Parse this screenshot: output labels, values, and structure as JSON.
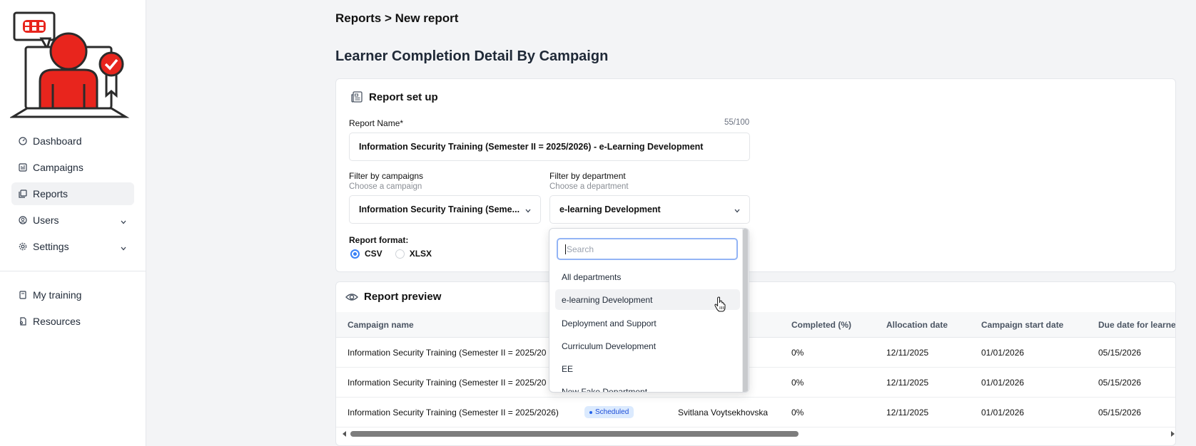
{
  "sidebar": {
    "items": [
      {
        "label": "Dashboard",
        "icon": "dashboard-icon"
      },
      {
        "label": "Campaigns",
        "icon": "campaigns-icon"
      },
      {
        "label": "Reports",
        "icon": "reports-icon",
        "active": true
      },
      {
        "label": "Users",
        "icon": "users-icon",
        "expandable": true
      },
      {
        "label": "Settings",
        "icon": "settings-icon",
        "expandable": true
      }
    ],
    "secondary": [
      {
        "label": "My training",
        "icon": "my-training-icon"
      },
      {
        "label": "Resources",
        "icon": "resources-icon"
      }
    ]
  },
  "breadcrumb": "Reports > New report",
  "page_title": "Learner Completion Detail By Campaign",
  "setup": {
    "heading": "Report set up",
    "report_name_label": "Report Name*",
    "report_name_counter": "55/100",
    "report_name_value": "Information Security Training (Semester II = 2025/2026) - e-Learning Development",
    "campaign_label": "Filter by campaigns",
    "campaign_sub": "Choose a campaign",
    "campaign_value": "Information Security Training (Seme...",
    "department_label": "Filter by department",
    "department_sub": "Choose a department",
    "department_value": "e-learning Development",
    "format_label": "Report format:",
    "format_options": [
      "CSV",
      "XLSX"
    ],
    "format_selected": "CSV"
  },
  "dropdown": {
    "search_placeholder": "Search",
    "options": [
      "All departments",
      "e-learning Development",
      "Deployment and Support",
      "Curriculum Development",
      "EE",
      "New Fake Department"
    ],
    "highlighted": "e-learning Development"
  },
  "preview": {
    "heading": "Report preview",
    "columns": [
      "Campaign name",
      "Completed (%)",
      "Allocation date",
      "Campaign start date",
      "Due date for learne"
    ],
    "rows": [
      {
        "campaign": "Information Security Training (Semester II = 2025/20",
        "status": "",
        "learner": "",
        "completed": "0%",
        "allocation": "12/11/2025",
        "start": "01/01/2026",
        "due": "05/15/2026"
      },
      {
        "campaign": "Information Security Training (Semester II = 2025/20",
        "status": "",
        "learner": "",
        "completed": "0%",
        "allocation": "12/11/2025",
        "start": "01/01/2026",
        "due": "05/15/2026"
      },
      {
        "campaign": "Information Security Training (Semester II = 2025/2026)",
        "status": "Scheduled",
        "learner": "Svitlana Voytsekhovska",
        "completed": "0%",
        "allocation": "12/11/2025",
        "start": "01/01/2026",
        "due": "05/15/2026"
      }
    ]
  },
  "colors": {
    "accent": "#3b82f6",
    "logo_red": "#e8251d",
    "badge_bg": "#dbeafe",
    "badge_text": "#1d4ed8"
  }
}
